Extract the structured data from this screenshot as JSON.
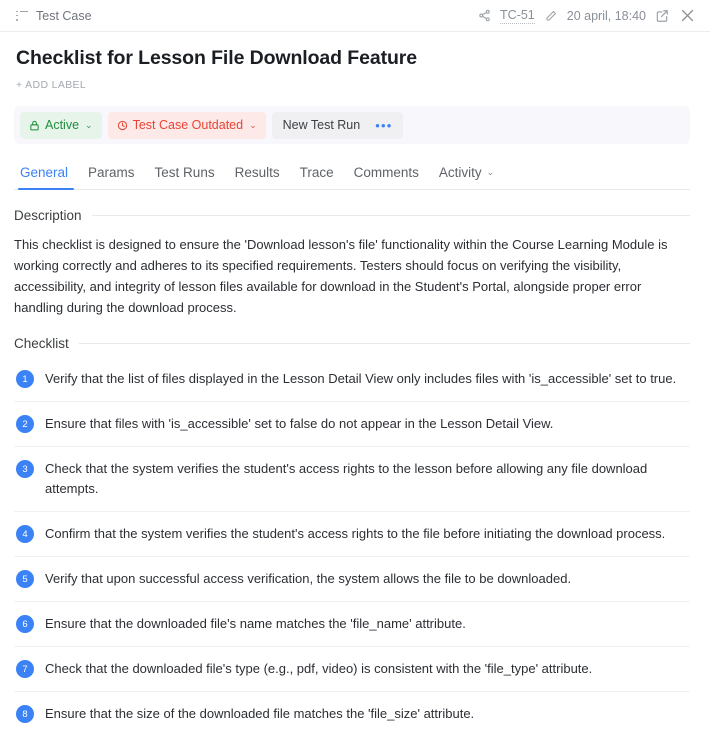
{
  "topbar": {
    "breadcrumb_label": "Test Case",
    "list_icon": "list-icon",
    "share_icon": "share-icon",
    "case_id": "TC-51",
    "pencil_icon": "pencil-icon",
    "date": "20 april, 18:40",
    "open_external_icon": "external-link-icon",
    "close_icon": "close-icon"
  },
  "header": {
    "title": "Checklist for Lesson File Download Feature",
    "add_label": "+ ADD LABEL"
  },
  "toolbar": {
    "status": {
      "label": "Active",
      "icon": "lock-icon",
      "chevron": "⌄",
      "color": "#1e8e3e",
      "background": "#e6f4ea"
    },
    "outdated": {
      "label": "Test Case Outdated",
      "icon": "clock-icon",
      "chevron": "⌄",
      "color": "#ea4335",
      "background": "#fde9e7"
    },
    "new_test_run": {
      "label": "New Test Run",
      "more_label": "•••",
      "more_color": "#3b82f6"
    }
  },
  "tabs": [
    {
      "label": "General",
      "active": true
    },
    {
      "label": "Params",
      "active": false
    },
    {
      "label": "Test Runs",
      "active": false
    },
    {
      "label": "Results",
      "active": false
    },
    {
      "label": "Trace",
      "active": false
    },
    {
      "label": "Comments",
      "active": false
    },
    {
      "label": "Activity",
      "active": false,
      "chevron": "⌄"
    }
  ],
  "description": {
    "heading": "Description",
    "body": "This checklist is designed to ensure the 'Download lesson's file' functionality within the Course Learning Module is working correctly and adheres to its specified requirements. Testers should focus on verifying the visibility, accessibility, and integrity of lesson files available for download in the Student's Portal, alongside proper error handling during the download process."
  },
  "checklist": {
    "heading": "Checklist",
    "items": [
      {
        "num": "1",
        "text": "Verify that the list of files displayed in the Lesson Detail View only includes files with 'is_accessible' set to true."
      },
      {
        "num": "2",
        "text": "Ensure that files with 'is_accessible' set to false do not appear in the Lesson Detail View."
      },
      {
        "num": "3",
        "text": "Check that the system verifies the student's access rights to the lesson before allowing any file download attempts."
      },
      {
        "num": "4",
        "text": "Confirm that the system verifies the student's access rights to the file before initiating the download process."
      },
      {
        "num": "5",
        "text": "Verify that upon successful access verification, the system allows the file to be downloaded."
      },
      {
        "num": "6",
        "text": "Ensure that the downloaded file's name matches the 'file_name' attribute."
      },
      {
        "num": "7",
        "text": "Check that the downloaded file's type (e.g., pdf, video) is consistent with the 'file_type' attribute."
      },
      {
        "num": "8",
        "text": "Ensure that the size of the downloaded file matches the 'file_size' attribute."
      }
    ]
  },
  "accent_color": "#3b82f6"
}
